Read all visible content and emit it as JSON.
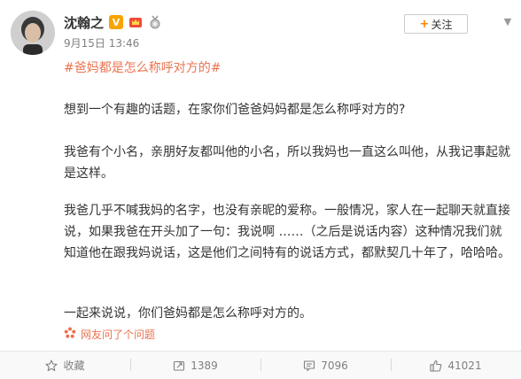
{
  "post": {
    "author": "沈翰之",
    "verified_badge": "V",
    "time": "9月15日 13:46",
    "follow_label": "关注",
    "hashtag": "#爸妈都是怎么称呼对方的#",
    "paragraphs": [
      "想到一个有趣的话题，在家你们爸爸妈妈都是怎么称呼对方的?",
      "我爸有个小名，亲朋好友都叫他的小名，所以我妈也一直这么叫他，从我记事起就是这样。",
      "我爸几乎不喊我妈的名字，也没有亲昵的爱称。一般情况，家人在一起聊天就直接说，如果我爸在开头加了一句：我说啊 ……（之后是说话内容）这种情况我们就知道他在跟我妈说话，这是他们之间特有的说话方式，都默契几十年了，哈哈哈。",
      "一起来说说，你们爸妈都是怎么称呼对方的。"
    ],
    "netizen_question": "网友问了个问题"
  },
  "actions": {
    "favorite": "收藏",
    "repost": "1389",
    "comment": "7096",
    "like": "41021"
  },
  "colors": {
    "link": "#eb7350",
    "accent": "#ff8200",
    "verified": "#f7a400",
    "meta": "#808080"
  },
  "icons": [
    "avatar",
    "verified-icon",
    "crown-icon",
    "medal-icon",
    "plus-icon",
    "chevron-down-icon",
    "question-icon",
    "star-icon",
    "repost-icon",
    "comment-icon",
    "thumb-up-icon"
  ]
}
